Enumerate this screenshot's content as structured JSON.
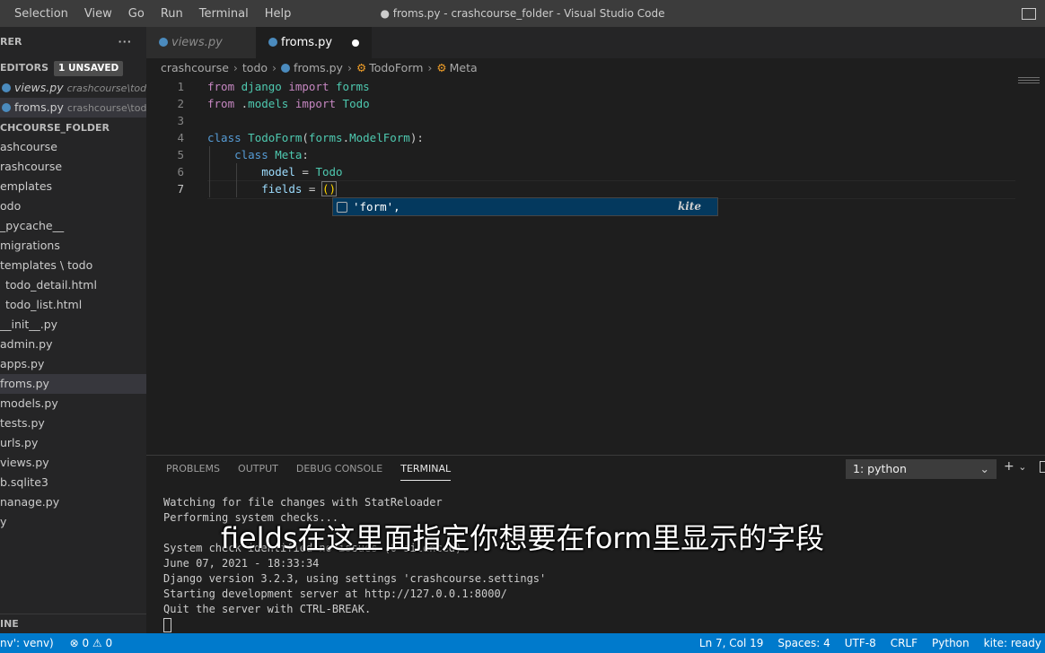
{
  "menu": [
    "Selection",
    "View",
    "Go",
    "Run",
    "Terminal",
    "Help"
  ],
  "window_title": "● froms.py - crashcourse_folder - Visual Studio Code",
  "sidebar": {
    "explorer_label": "RER",
    "open_editors_label": "EDITORS",
    "unsaved_badge": "1 UNSAVED",
    "open_files": [
      {
        "name": "views.py",
        "path": "crashcourse\\todo"
      },
      {
        "name": "froms.py",
        "path": "crashcourse\\todo"
      }
    ],
    "folder_label": "CHCOURSE_FOLDER",
    "tree": [
      "ashcourse",
      "rashcourse",
      "emplates",
      "odo",
      "_pycache__",
      "migrations",
      "templates \\ todo",
      "todo_detail.html",
      "todo_list.html",
      "__init__.py",
      "admin.py",
      "apps.py",
      "froms.py",
      "models.py",
      "tests.py",
      "urls.py",
      "views.py",
      "b.sqlite3",
      "nanage.py",
      "y"
    ],
    "outline_label": "INE"
  },
  "tabs": [
    {
      "label": "views.py",
      "active": false
    },
    {
      "label": "froms.py",
      "active": true
    }
  ],
  "breadcrumb": [
    "crashcourse",
    "todo",
    "froms.py",
    "TodoForm",
    "Meta"
  ],
  "code_lines": [
    {
      "num": "1",
      "tokens": [
        {
          "t": "from",
          "c": "kw"
        },
        {
          "t": " ",
          "c": ""
        },
        {
          "t": "django",
          "c": "cls"
        },
        {
          "t": " ",
          "c": ""
        },
        {
          "t": "import",
          "c": "kw"
        },
        {
          "t": " ",
          "c": ""
        },
        {
          "t": "forms",
          "c": "cls"
        }
      ]
    },
    {
      "num": "2",
      "tokens": [
        {
          "t": "from",
          "c": "kw"
        },
        {
          "t": " .",
          "c": ""
        },
        {
          "t": "models",
          "c": "cls"
        },
        {
          "t": " ",
          "c": ""
        },
        {
          "t": "import",
          "c": "kw"
        },
        {
          "t": " ",
          "c": ""
        },
        {
          "t": "Todo",
          "c": "cls"
        }
      ]
    },
    {
      "num": "3",
      "tokens": []
    },
    {
      "num": "4",
      "tokens": [
        {
          "t": "class",
          "c": "kw2"
        },
        {
          "t": " ",
          "c": ""
        },
        {
          "t": "TodoForm",
          "c": "cls"
        },
        {
          "t": "(",
          "c": ""
        },
        {
          "t": "forms",
          "c": "cls"
        },
        {
          "t": ".",
          "c": ""
        },
        {
          "t": "ModelForm",
          "c": "cls"
        },
        {
          "t": "):",
          "c": ""
        }
      ]
    },
    {
      "num": "5",
      "tokens": [
        {
          "t": "    ",
          "c": ""
        },
        {
          "t": "class",
          "c": "kw2"
        },
        {
          "t": " ",
          "c": ""
        },
        {
          "t": "Meta",
          "c": "cls"
        },
        {
          "t": ":",
          "c": ""
        }
      ]
    },
    {
      "num": "6",
      "tokens": [
        {
          "t": "        ",
          "c": ""
        },
        {
          "t": "model",
          "c": "var"
        },
        {
          "t": " = ",
          "c": ""
        },
        {
          "t": "Todo",
          "c": "cls"
        }
      ]
    },
    {
      "num": "7",
      "tokens": [
        {
          "t": "        ",
          "c": ""
        },
        {
          "t": "fields",
          "c": "var"
        },
        {
          "t": " = ",
          "c": ""
        },
        {
          "t": "()",
          "c": "paren"
        }
      ]
    }
  ],
  "suggestion": {
    "text": "'form',",
    "source": "kite"
  },
  "panel": {
    "tabs": [
      "PROBLEMS",
      "OUTPUT",
      "DEBUG CONSOLE",
      "TERMINAL"
    ],
    "active_tab": "TERMINAL",
    "terminal_select": "1: python",
    "terminal_lines": [
      "Watching for file changes with StatReloader",
      "Performing system checks...",
      "",
      "System check identified no issues (0 silenced).",
      "June 07, 2021 - 18:33:34",
      "Django version 3.2.3, using settings 'crashcourse.settings'",
      "Starting development server at http://127.0.0.1:8000/",
      "Quit the server with CTRL-BREAK."
    ]
  },
  "subtitle": "fields在这里面指定你想要在form里显示的字段",
  "statusbar": {
    "left": "nv': venv)",
    "problems": "⊗ 0 ⚠ 0",
    "ln_col": "Ln 7, Col 19",
    "spaces": "Spaces: 4",
    "encoding": "UTF-8",
    "eol": "CRLF",
    "language": "Python",
    "kite": "kite: ready"
  },
  "colors": {
    "accent": "#007acc",
    "keyword": "#c586c0",
    "class": "#4ec9b0",
    "variable": "#9cdcfe"
  }
}
